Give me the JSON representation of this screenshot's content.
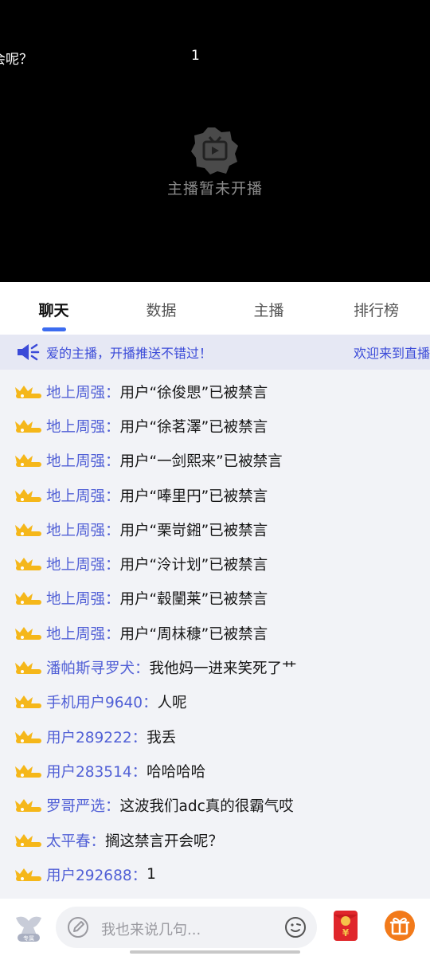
{
  "video": {
    "danmaku": [
      "会呢？",
      "1"
    ],
    "offline_text": "主播暂未开播"
  },
  "tabs": [
    {
      "label": "聊天",
      "active": true
    },
    {
      "label": "数据",
      "active": false
    },
    {
      "label": "主播",
      "active": false
    },
    {
      "label": "排行榜",
      "active": false
    }
  ],
  "notice": {
    "text": "爱的主播，开播推送不错过！",
    "text2": "欢迎来到直播间"
  },
  "chat": [
    {
      "user": "地上周强：",
      "text": "用户“徐俊愳”已被禁言"
    },
    {
      "user": "地上周强：",
      "text": "用户“徐茗澤”已被禁言"
    },
    {
      "user": "地上周强：",
      "text": "用户“一剑熙来”已被禁言"
    },
    {
      "user": "地上周强：",
      "text": "用户“唪里円”已被禁言"
    },
    {
      "user": "地上周强：",
      "text": "用户“栗岢鎺”已被禁言"
    },
    {
      "user": "地上周强：",
      "text": "用户“泠计划”已被禁言"
    },
    {
      "user": "地上周强：",
      "text": "用户“毂闉莱”已被禁言"
    },
    {
      "user": "地上周强：",
      "text": "用户“周枺穅”已被禁言"
    },
    {
      "user": "潘帕斯寻罗犬：",
      "text": "我他妈一进来笑死了艹"
    },
    {
      "user": "手机用户9640：",
      "text": "人呢"
    },
    {
      "user": "用户289222：",
      "text": "我丢"
    },
    {
      "user": "用户283514：",
      "text": "哈哈哈哈"
    },
    {
      "user": "罗哥严选：",
      "text": "这波我们adc真的很霸气哎"
    },
    {
      "user": "太平春：",
      "text": "搁这禁言开会呢？"
    },
    {
      "user": "用户292688：",
      "text": "1"
    }
  ],
  "bottom": {
    "logo_text": "专属",
    "input_placeholder": "我也来说几句...",
    "redpack_symbol": "¥"
  },
  "colors": {
    "accent": "#3c6cf0",
    "username": "#5160d6",
    "gift": "#f27a1a",
    "redpack": "#e0262b",
    "badge": "#f5b71a"
  }
}
